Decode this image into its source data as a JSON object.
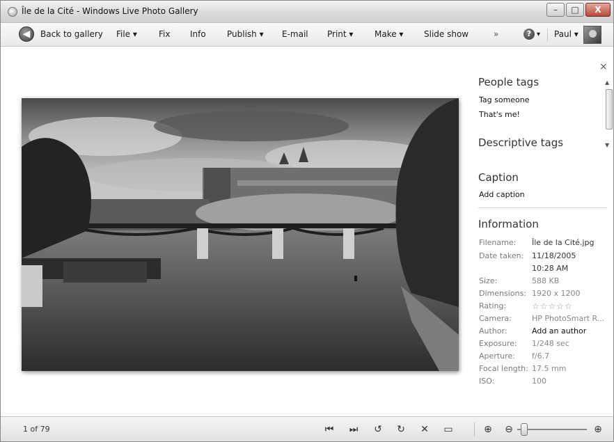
{
  "window": {
    "title": "Île de la Cité - Windows Live Photo Gallery",
    "min_label": "–",
    "max_label": "□",
    "close_label": "X"
  },
  "toolbar": {
    "back_icon": "◀",
    "back_label": "Back to gallery",
    "file_label": "File ▾",
    "fix_label": "Fix",
    "info_label": "Info",
    "publish_label": "Publish ▾",
    "email_label": "E-mail",
    "print_label": "Print ▾",
    "make_label": "Make ▾",
    "slideshow_label": "Slide show",
    "overflow_label": "»",
    "help_icon": "?",
    "help_arrow": "▾",
    "user_label": "Paul ▾"
  },
  "panel": {
    "close_label": "×",
    "scroll_up": "▲",
    "scroll_down": "▼",
    "people_tags": {
      "heading": "People tags",
      "links": [
        "Tag someone",
        "That's me!"
      ]
    },
    "descriptive_tags": {
      "heading": "Descriptive tags"
    },
    "caption": {
      "heading": "Caption",
      "link": "Add caption"
    },
    "information": {
      "heading": "Information",
      "rows": [
        {
          "label": "Filename:",
          "value": "Île de la Cité.jpg"
        },
        {
          "label": "Date taken:",
          "value": "11/18/2005"
        },
        {
          "label": "",
          "value": "10:28 AM"
        },
        {
          "label": "Size:",
          "value": "588 KB"
        },
        {
          "label": "Dimensions:",
          "value": "1920 x 1200"
        },
        {
          "label": "Rating:",
          "value": "☆☆☆☆☆",
          "rating": 0
        },
        {
          "label": "Camera:",
          "value": "HP PhotoSmart R..."
        },
        {
          "label": "Author:",
          "value": "Add an author"
        },
        {
          "label": "Exposure:",
          "value": "1/248 sec"
        },
        {
          "label": "Aperture:",
          "value": "f/6.7"
        },
        {
          "label": "Focal length:",
          "value": "17.5 mm"
        },
        {
          "label": "ISO:",
          "value": "100"
        }
      ]
    }
  },
  "statusbar": {
    "page_count": "1 of 79",
    "buttons": {
      "previous": "⏮",
      "next": "⏭",
      "rotate_ccw": "↺",
      "rotate_cw": "↻",
      "delete": "✕",
      "slideshow": "▭",
      "fit": "⊕",
      "zoom_out": "⊖",
      "zoom_in": "⊕"
    },
    "zoom_level": 0.05
  }
}
